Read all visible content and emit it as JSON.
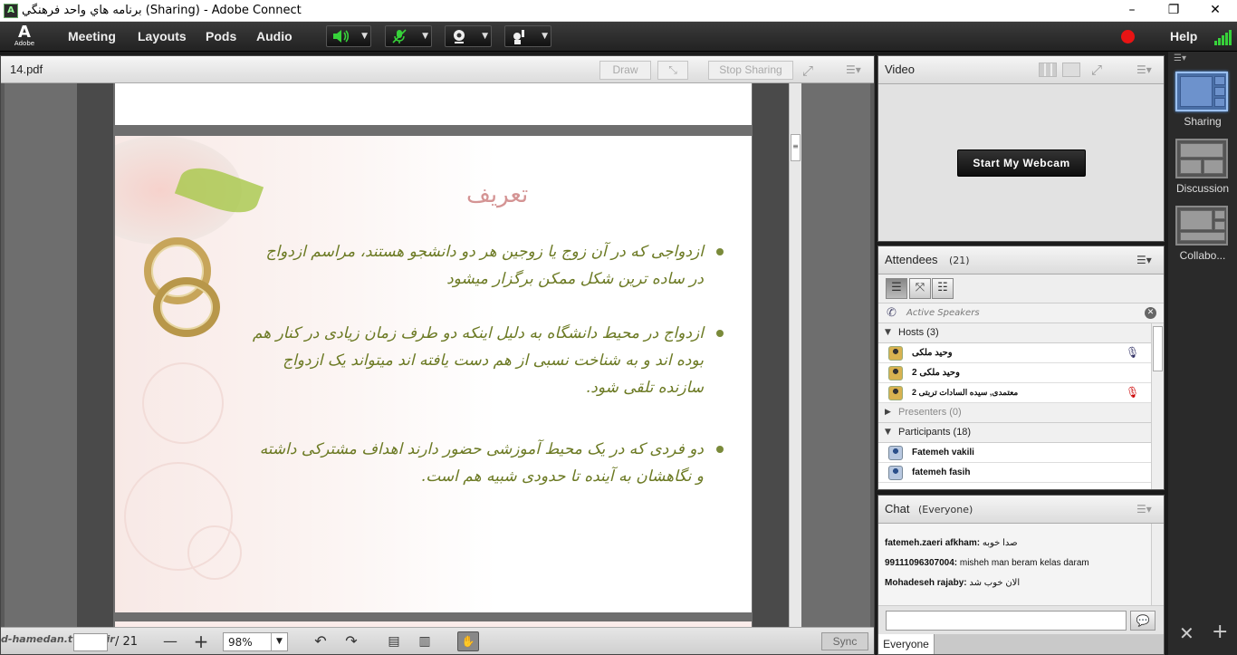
{
  "window": {
    "title": "برنامه هاي واحد فرهنگي (Sharing) - Adobe Connect",
    "minimize": "–",
    "restore": "❐",
    "close": "✕"
  },
  "menubar": {
    "logo_letter": "A",
    "logo_text": "Adobe",
    "items": [
      "Meeting",
      "Layouts",
      "Pods",
      "Audio"
    ],
    "help": "Help",
    "speaker_color": "#37d23a",
    "mic_color": "#37d23a",
    "record_color": "#e81414"
  },
  "share_pod": {
    "title": "14.pdf",
    "draw_label": "Draw",
    "stop_sharing_label": "Stop Sharing",
    "current_page": "",
    "page_count": "/ 21",
    "zoom": "98%",
    "sync_label": "Sync",
    "watermark": "d-hamedan.tvu.ac.ir",
    "slide": {
      "title": "تعریف",
      "bullets": [
        "ازدواجی که در آن زوج یا زوجین هر دو دانشجو هستند، مراسم ازدواج در ساده ترین شکل ممکن برگزار میشود",
        "ازدواج در محیط دانشگاه به دلیل اینکه دو طرف زمان زیادی در کنار هم بوده اند و به شناخت نسبی از هم دست یافته اند میتواند یک ازدواج سازنده تلقی شود.",
        "دو فردی که در یک محیط آموزشی حضور دارند اهداف مشترکی داشته و نگاهشان به آینده تا حدودی شبیه هم است."
      ]
    }
  },
  "video_pod": {
    "title": "Video",
    "start_webcam_label": "Start My Webcam"
  },
  "attendees_pod": {
    "title": "Attendees",
    "count": "(21)",
    "active_speakers_label": "Active Speakers",
    "hosts_label": "Hosts (3)",
    "presenters_label": "Presenters (0)",
    "participants_label": "Participants (18)",
    "hosts": [
      {
        "name": "وحید ملکی"
      },
      {
        "name": "وحید ملکی 2"
      },
      {
        "name": "معتمدی, سیده السادات تربتی 2"
      }
    ],
    "participants": [
      {
        "name": "Fatemeh  vakili"
      },
      {
        "name": "fatemeh fasih"
      }
    ]
  },
  "chat_pod": {
    "title": "Chat",
    "scope": "(Everyone)",
    "messages": [
      {
        "sender": "fatemeh.zaeri afkham:",
        "text": "صدا خوبه"
      },
      {
        "sender": "99111096307004:",
        "text": "misheh man beram kelas daram"
      },
      {
        "sender": "Mohadeseh rajaby:",
        "text": "الان خوب شد"
      }
    ],
    "input_value": "",
    "tab_label": "Everyone"
  },
  "layouts": {
    "items": [
      {
        "label": "Sharing"
      },
      {
        "label": "Discussion"
      },
      {
        "label": "Collabo..."
      }
    ]
  }
}
